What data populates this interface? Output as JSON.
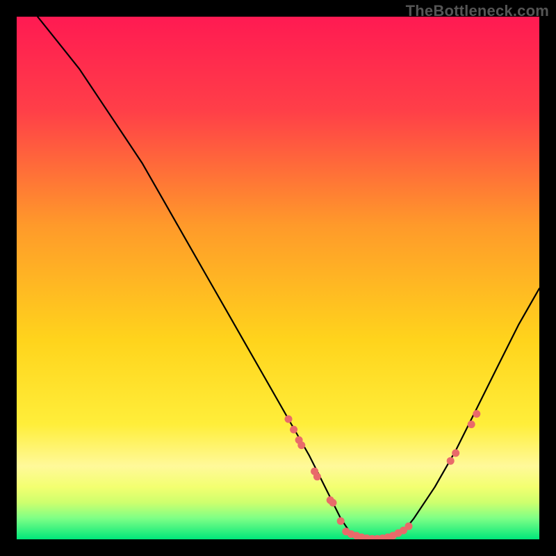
{
  "watermark": "TheBottleneck.com",
  "chart_data": {
    "type": "line",
    "title": "",
    "xlabel": "",
    "ylabel": "",
    "xlim": [
      0,
      100
    ],
    "ylim": [
      0,
      100
    ],
    "background_gradient": {
      "top_color": "#ff1a52",
      "mid_color": "#ffe200",
      "bottom_colors": [
        "#fff99a",
        "#f3ff70",
        "#9cff70",
        "#00e67a"
      ]
    },
    "curve": {
      "description": "V-shaped bottleneck curve: steep drop from top-left, flat minimum near x=62-75, rising again to right edge",
      "x": [
        4,
        8,
        12,
        16,
        20,
        24,
        28,
        32,
        36,
        40,
        44,
        48,
        52,
        56,
        58,
        60,
        62,
        64,
        66,
        68,
        70,
        72,
        74,
        76,
        80,
        84,
        88,
        92,
        96,
        100
      ],
      "y": [
        100,
        95,
        90,
        84,
        78,
        72,
        65,
        58,
        51,
        44,
        37,
        30,
        23,
        16,
        12,
        8,
        4,
        1,
        0,
        0,
        0,
        0.5,
        1.5,
        4,
        10,
        17,
        25,
        33,
        41,
        48
      ]
    },
    "dots": {
      "color": "#e96a6a",
      "points": [
        {
          "x": 52,
          "y": 23
        },
        {
          "x": 53,
          "y": 21
        },
        {
          "x": 54,
          "y": 19
        },
        {
          "x": 54.5,
          "y": 18
        },
        {
          "x": 57,
          "y": 13
        },
        {
          "x": 57.5,
          "y": 12
        },
        {
          "x": 60,
          "y": 7.5
        },
        {
          "x": 60.5,
          "y": 7
        },
        {
          "x": 62,
          "y": 3.5
        },
        {
          "x": 63,
          "y": 1.5
        },
        {
          "x": 64,
          "y": 1
        },
        {
          "x": 65,
          "y": 0.7
        },
        {
          "x": 66,
          "y": 0.4
        },
        {
          "x": 67,
          "y": 0.2
        },
        {
          "x": 68,
          "y": 0.1
        },
        {
          "x": 69,
          "y": 0.1
        },
        {
          "x": 70,
          "y": 0.2
        },
        {
          "x": 71,
          "y": 0.4
        },
        {
          "x": 72,
          "y": 0.7
        },
        {
          "x": 73,
          "y": 1.2
        },
        {
          "x": 74,
          "y": 1.7
        },
        {
          "x": 75,
          "y": 2.5
        },
        {
          "x": 83,
          "y": 15
        },
        {
          "x": 84,
          "y": 16.5
        },
        {
          "x": 87,
          "y": 22
        },
        {
          "x": 88,
          "y": 24
        }
      ]
    }
  }
}
